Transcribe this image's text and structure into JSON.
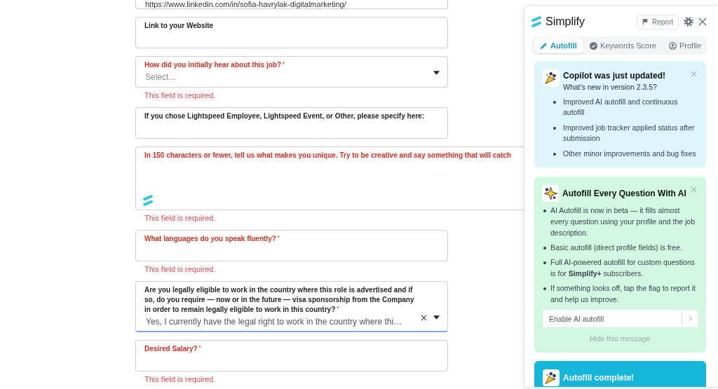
{
  "form": {
    "fields": [
      {
        "kind": "text",
        "value": "https://www.linkedin.com/in/sofia-havrylak-digitalmarketing/",
        "focused": false,
        "simplify_badge": false
      },
      {
        "kind": "text",
        "label": "Link to your Website",
        "focused": false,
        "simplify_badge": false
      },
      {
        "kind": "select",
        "label": "How did you initially hear about this job?",
        "required_mark": "*",
        "placeholder": "Select...",
        "focused": false,
        "simplify_badge": false,
        "error": "This field is required."
      },
      {
        "kind": "text",
        "label": "If you chose Lightspeed Employee, Lightspeed Event, or Other, please specify here:",
        "focused": false,
        "simplify_badge": false
      },
      {
        "kind": "textarea",
        "label": "In 150 characters or fewer, tell us what makes you unique. Try to be creative and say something that will catch",
        "focused": false,
        "simplify_badge": true,
        "error": "This field is required."
      },
      {
        "kind": "text",
        "label": "What languages do you speak fluently?",
        "required_mark": "*",
        "focused": false,
        "simplify_badge": false,
        "error": "This field is required."
      },
      {
        "kind": "select",
        "label": "Are you legally eligible to work in the country where this role is advertised and if so, do you require — now or in the future — visa sponsorship from the Company in order to remain legally eligible to work in this country?",
        "required_mark": "*",
        "value": "Yes, I currently have the legal right to work in the country where thi…",
        "focused": true,
        "simplify_badge": false
      },
      {
        "kind": "text",
        "label": "Desired Salary?",
        "required_mark": "*",
        "focused": false,
        "simplify_badge": false,
        "error": "This field is required."
      }
    ]
  },
  "panel": {
    "brand": "Simplify",
    "report_button": "Report",
    "tabs": [
      {
        "label": "Autofill",
        "selected": true
      },
      {
        "label": "Keywords Score",
        "selected": false
      },
      {
        "label": "Profile",
        "selected": false
      }
    ],
    "cards": [
      {
        "kind": "update",
        "title": "Copilot was just updated!",
        "subtitle": "What's new in version 2.3.5?",
        "bullets": [
          "Improved AI autofill and continuous autofill",
          "Improved job tracker applied status after submission",
          "Other minor improvements and bug fixes"
        ]
      },
      {
        "kind": "promo",
        "title": "Autofill Every Question With AI",
        "bullets": [
          "AI Autofill is now in beta — it fills almost every question using your profile and the job description.",
          "Basic autofill (direct profile fields) is free.",
          "Full AI-powered autofill for custom questions is for **Simplify+** subscribers.",
          "If something looks off, tap the flag to report it and help us improve."
        ],
        "action": "Enable AI autofill",
        "dismiss_link": "Hide this message"
      },
      {
        "kind": "status",
        "title": "Autofill complete!"
      }
    ]
  }
}
